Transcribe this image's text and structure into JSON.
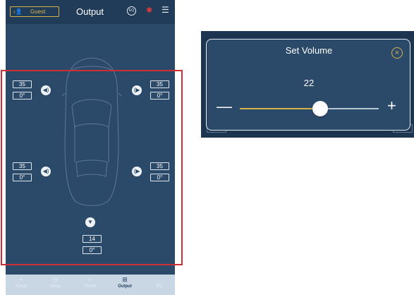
{
  "header": {
    "guest_label": "Guest",
    "title": "Output",
    "eq_icon_text": "EQ",
    "icons": [
      "guest-icon",
      "back-chevron-icon",
      "eq-icon",
      "bluetooth-icon",
      "menu-icon"
    ]
  },
  "speakers": {
    "front_left": {
      "level": "35",
      "phase": "0°"
    },
    "front_right": {
      "level": "35",
      "phase": "0°"
    },
    "rear_left": {
      "level": "35",
      "phase": "0°"
    },
    "rear_right": {
      "level": "35",
      "phase": "0°"
    },
    "subwoofer": {
      "level": "14",
      "phase": "0°"
    }
  },
  "nav": {
    "items": [
      {
        "label": "XOver",
        "icon": "xover-icon"
      },
      {
        "label": "Delay",
        "icon": "clock-icon"
      },
      {
        "label": "Home",
        "icon": "home-icon"
      },
      {
        "label": "Output",
        "icon": "grid-icon",
        "active": true
      },
      {
        "label": "EQ",
        "icon": "sliders-icon"
      }
    ]
  },
  "volume_dialog": {
    "title": "Set Volume",
    "value": "22",
    "minus_label": "—",
    "plus_label": "+",
    "level": 22,
    "max": 38
  },
  "colors": {
    "background": "#2b4a6a",
    "topbar": "#213c58",
    "accent": "#d7b24a",
    "highlight_frame": "#cc2f36",
    "bluetooth": "#e03a3a"
  }
}
